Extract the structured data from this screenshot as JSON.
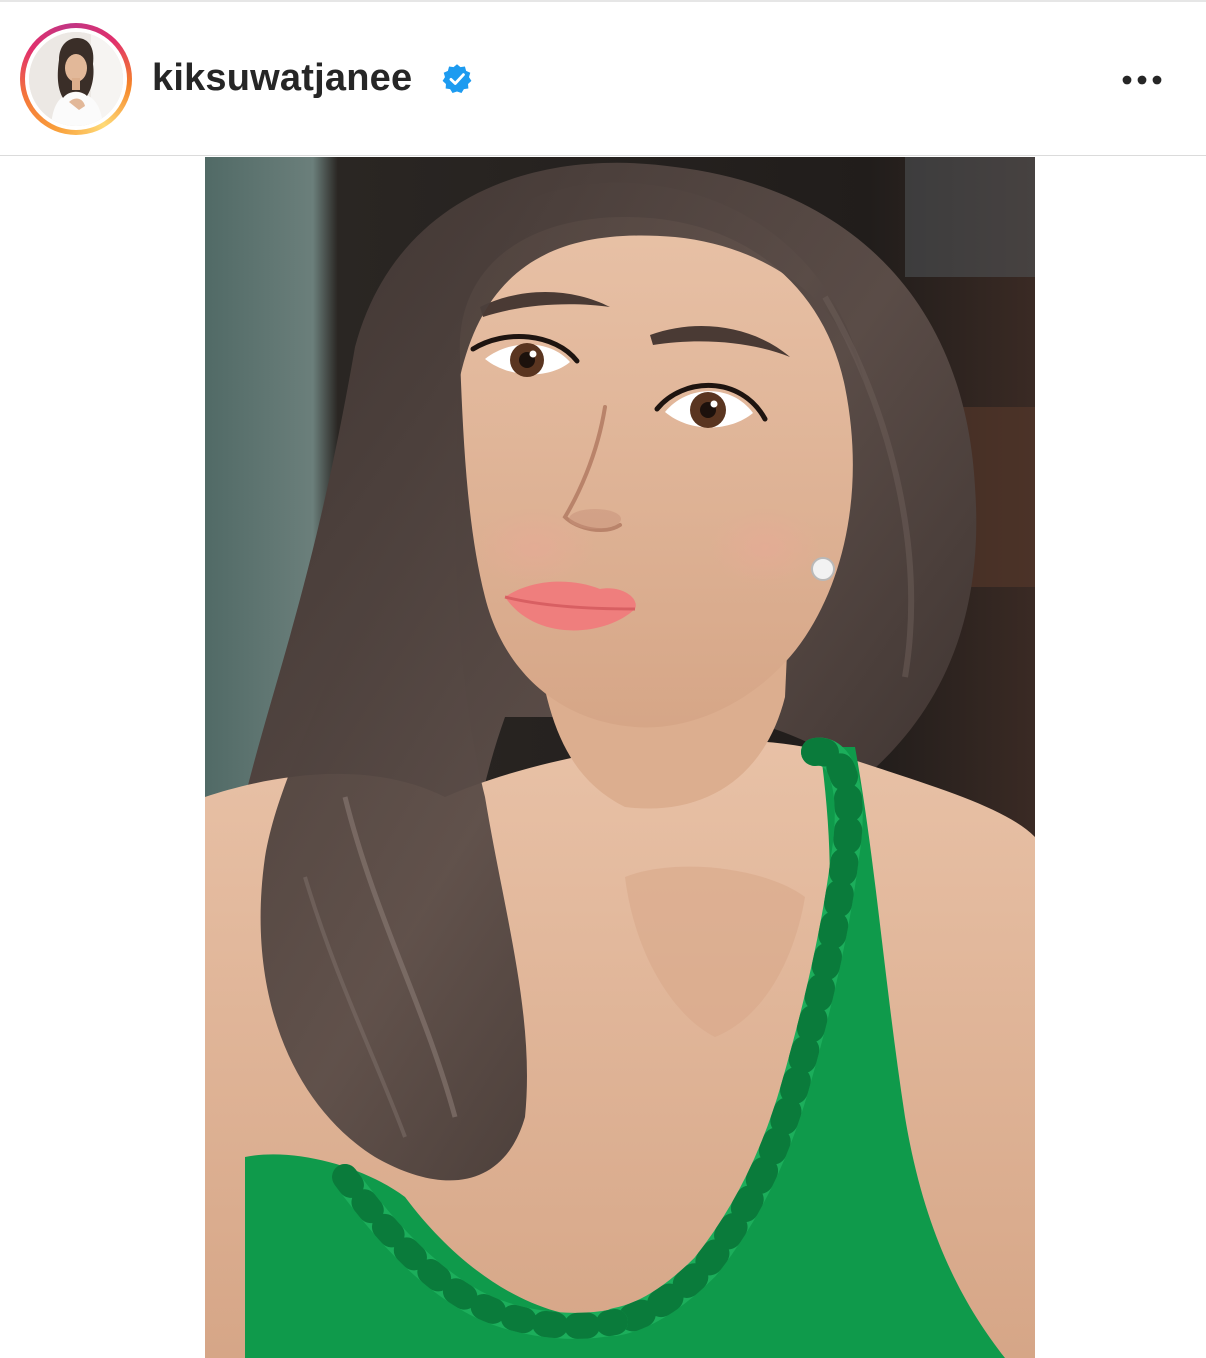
{
  "post": {
    "username": "kiksuwatjanee",
    "verified": true,
    "verified_icon": "verified-badge-icon",
    "more_icon": "more-horizontal-icon",
    "more_label": "More options"
  },
  "colors": {
    "username": "#262626",
    "verified": "#1d9bf0",
    "divider": "#dbdbdb",
    "story_ring": [
      "#feda77",
      "#f58529",
      "#e1306c",
      "#c13584"
    ]
  }
}
